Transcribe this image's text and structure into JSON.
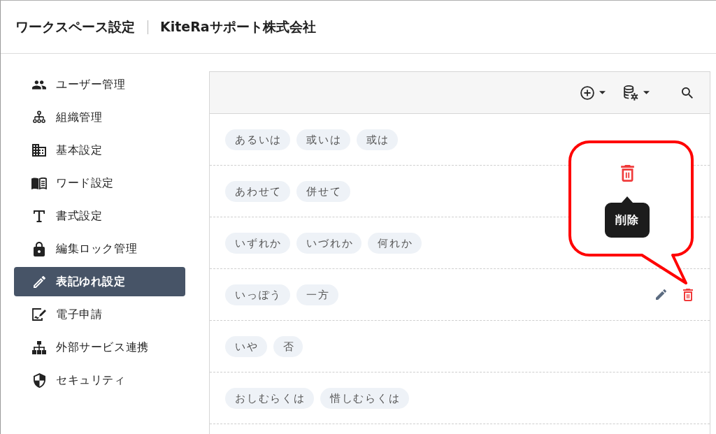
{
  "header": {
    "title": "ワークスペース設定",
    "organization": "KiteRaサポート株式会社"
  },
  "sidebar": {
    "items": [
      {
        "label": "ユーザー管理",
        "selected": false
      },
      {
        "label": "組織管理",
        "selected": false
      },
      {
        "label": "基本設定",
        "selected": false
      },
      {
        "label": "ワード設定",
        "selected": false
      },
      {
        "label": "書式設定",
        "selected": false
      },
      {
        "label": "編集ロック管理",
        "selected": false
      },
      {
        "label": "表記ゆれ設定",
        "selected": true
      },
      {
        "label": "電子申請",
        "selected": false
      },
      {
        "label": "外部サービス連携",
        "selected": false
      },
      {
        "label": "セキュリティ",
        "selected": false
      }
    ]
  },
  "rows": [
    {
      "terms": [
        "あるいは",
        "或いは",
        "或は"
      ],
      "hovered": false
    },
    {
      "terms": [
        "あわせて",
        "併せて"
      ],
      "hovered": false
    },
    {
      "terms": [
        "いずれか",
        "いづれか",
        "何れか"
      ],
      "hovered": false
    },
    {
      "terms": [
        "いっぽう",
        "一方"
      ],
      "hovered": true
    },
    {
      "terms": [
        "いや",
        "否"
      ],
      "hovered": false
    },
    {
      "terms": [
        "おしむらくは",
        "惜しむらくは"
      ],
      "hovered": false
    }
  ],
  "callout": {
    "tooltip": "削除"
  }
}
